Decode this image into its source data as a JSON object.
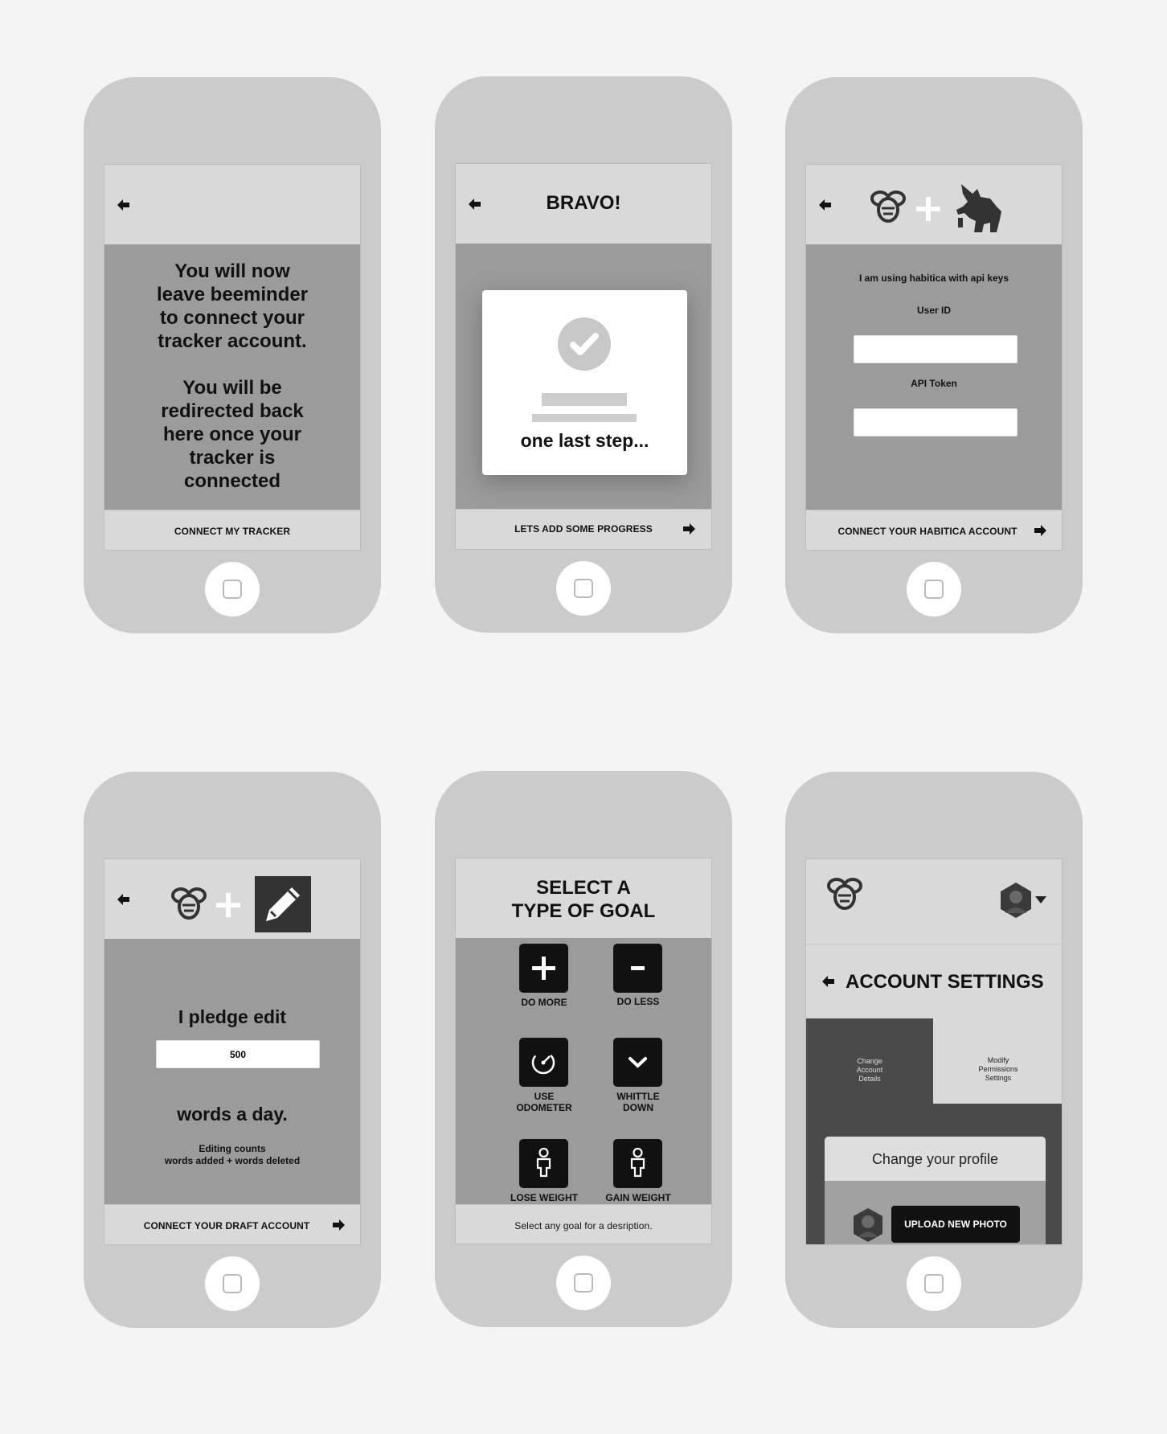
{
  "colors": {
    "background": "#f4f4f4",
    "phone": "#cbcbcb",
    "screen": "#9b9b9b",
    "header": "#d9d9d9",
    "dark": "#111111"
  },
  "screen1": {
    "message_lines_1": [
      "You will now",
      "leave beeminder",
      "to connect your",
      "tracker account."
    ],
    "message_lines_2": [
      "You will be",
      "redirected back",
      "here once your",
      "tracker is",
      "connected"
    ],
    "footer_button": "CONNECT MY TRACKER"
  },
  "screen2": {
    "title": "BRAVO!",
    "card_text": "one last step...",
    "footer_button": "LETS ADD SOME PROGRESS"
  },
  "screen3": {
    "logos": [
      "bee-logo-icon",
      "plus-icon",
      "griffin-logo-icon"
    ],
    "intro": "I am using habitica with api keys",
    "user_id_label": "User ID",
    "user_id_value": "",
    "api_token_label": "API Token",
    "api_token_value": "",
    "footer_button": "CONNECT YOUR HABITICA ACCOUNT"
  },
  "screen4": {
    "logos": [
      "bee-logo-icon",
      "plus-icon",
      "pencil-icon"
    ],
    "pledge": "I pledge edit",
    "amount": "500",
    "unit": "words a day.",
    "note_line1": "Editing counts",
    "note_line2": "words added + words deleted",
    "footer_button": "CONNECT YOUR DRAFT ACCOUNT"
  },
  "screen5": {
    "title_line1": "SELECT A",
    "title_line2": "TYPE OF GOAL",
    "goals": [
      {
        "icon": "plus-icon",
        "label1": "DO MORE",
        "label2": ""
      },
      {
        "icon": "minus-icon",
        "label1": "DO LESS",
        "label2": ""
      },
      {
        "icon": "odometer-icon",
        "label1": "USE",
        "label2": "ODOMETER"
      },
      {
        "icon": "chevron-down-icon",
        "label1": "WHITTLE",
        "label2": "DOWN"
      },
      {
        "icon": "person-icon",
        "label1": "LOSE WEIGHT",
        "label2": ""
      },
      {
        "icon": "person-icon",
        "label1": "GAIN WEIGHT",
        "label2": ""
      }
    ],
    "footer_text": "Select any goal for a desription."
  },
  "screen6": {
    "title": "ACCOUNT SETTINGS",
    "tab1": [
      "Change",
      "Account",
      "Details"
    ],
    "tab2": [
      "Modify",
      "Permissions",
      "Settings"
    ],
    "profile_header": "Change your profile",
    "upload_button": "UPLOAD NEW PHOTO"
  }
}
